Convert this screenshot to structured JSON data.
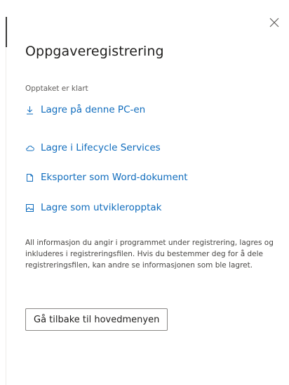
{
  "panel": {
    "title": "Oppgaveregistrering",
    "status": "Opptaket er klart",
    "close_icon": "close-icon"
  },
  "actions": [
    {
      "label": "Lagre på denne PC-en",
      "icon": "download-icon"
    },
    {
      "label": "Lagre i Lifecycle Services",
      "icon": "cloud-icon"
    },
    {
      "label": "Eksporter som Word-dokument",
      "icon": "document-icon"
    },
    {
      "label": "Lagre som utvikleropptak",
      "icon": "image-icon"
    }
  ],
  "info_text": "All informasjon du angir i programmet under registrering, lagres og inkluderes i registreringsfilen. Hvis du bestemmer deg for å dele registreringsfilen, kan andre se informasjonen som ble lagret.",
  "back_button_label": "Gå tilbake til hovedmenyen",
  "colors": {
    "link": "#0f6cbd",
    "text": "#201f1e",
    "muted": "#605e5c",
    "border": "#8a8886"
  }
}
